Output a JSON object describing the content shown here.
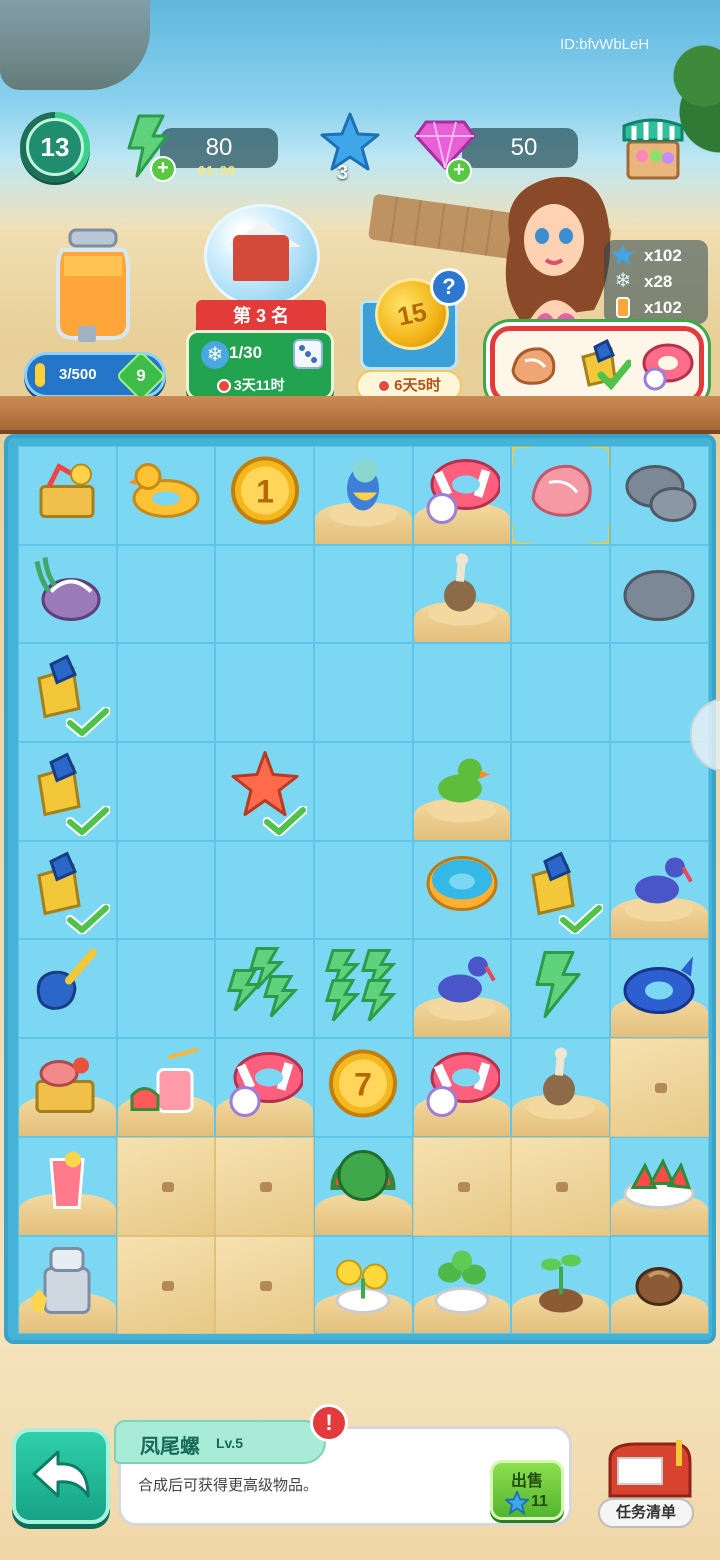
{
  "watermark": "ID:bfvWbLeH",
  "top_bar": {
    "level": "13",
    "energy": {
      "value": "80",
      "timer": "01:39",
      "plus": "+"
    },
    "stars": "3",
    "gems": {
      "value": "50",
      "plus": "+"
    },
    "icons": [
      "level-ring-icon",
      "energy-bolt-icon",
      "star-icon",
      "gem-icon",
      "shop-stall-icon"
    ]
  },
  "jar": {
    "progress_text": "3/500",
    "progress": 0.006,
    "level": "9"
  },
  "event": {
    "rank": "第 3 名",
    "progress_text": "1/30",
    "timer": "3天11时"
  },
  "coin_box": {
    "coin": "15",
    "help": "?",
    "timer": "6天5时"
  },
  "rewards": [
    {
      "icon": "star-icon",
      "text": "x102"
    },
    {
      "icon": "snowflake-icon",
      "text": "x28"
    },
    {
      "icon": "juice-icon",
      "text": "x102"
    }
  ],
  "orders": [
    "conch-shell-icon",
    "shovel-bucket-icon",
    "swim-ring-icon"
  ],
  "board": {
    "rows": [
      [
        "beach-basket",
        "duck-float",
        "coin-1",
        "parrot-blue",
        "swim-ring",
        "conch-selected",
        "rocks"
      ],
      [
        "coral-shell",
        "empty",
        "empty",
        "empty",
        "seagull",
        "empty",
        "rock"
      ],
      [
        "shovel-done",
        "empty",
        "empty",
        "empty",
        "empty",
        "empty",
        "empty"
      ],
      [
        "shovel-done",
        "empty",
        "starfish-done",
        "empty",
        "parrot-green",
        "empty",
        "empty"
      ],
      [
        "shovel-done",
        "empty",
        "empty",
        "empty",
        "donut-float",
        "shovel-done",
        "bird-blue"
      ],
      [
        "shovel",
        "empty",
        "energy-3",
        "energy-4",
        "bird-blue",
        "energy-1",
        "whale-float"
      ],
      [
        "meat-basket",
        "fruit-punch",
        "swim-ring",
        "coin-7",
        "swim-ring",
        "seagull",
        "sand"
      ],
      [
        "juice-glass",
        "sand",
        "sand",
        "watermelon",
        "sand",
        "sand",
        "watermelon-plate"
      ],
      [
        "juicer",
        "sand",
        "sand",
        "flower-pot",
        "plant-pot",
        "sprout",
        "seed"
      ]
    ],
    "coin_labels": {
      "coin-1": "1",
      "coin-7": "7"
    }
  },
  "selected_item": {
    "name": "凤尾螺",
    "level": "Lv.5",
    "alert": "!",
    "description": "合成后可获得更高级物品。",
    "sell_label": "出售",
    "sell_price": "11"
  },
  "task_list_label": "任务清单",
  "colors": {
    "board": "#45b3d8",
    "cell": "#7cd7f3",
    "done": "#5cc45a",
    "sand": "#e7c887",
    "select": "#ffc928"
  }
}
